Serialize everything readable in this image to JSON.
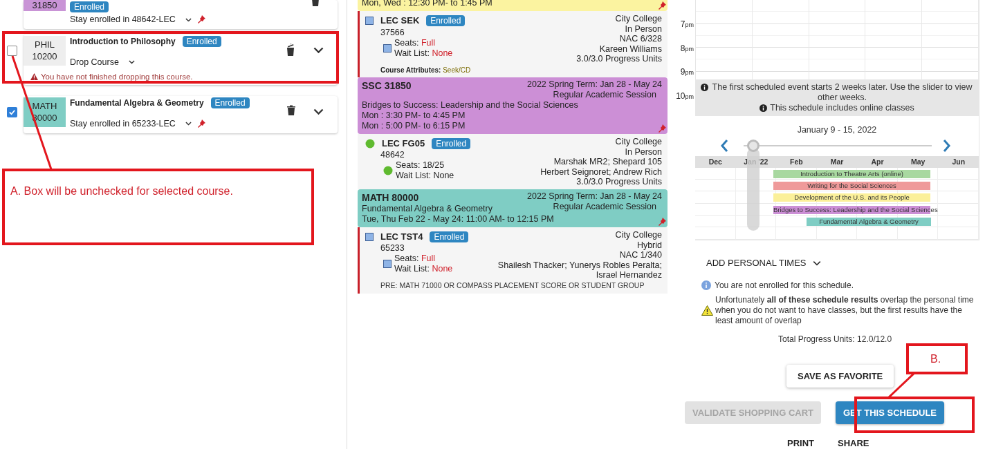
{
  "cart": [
    {
      "code": [
        "31850"
      ],
      "color": "#c994d6",
      "badge": "Enrolled",
      "action": "Stay enrolled in 48642-LEC",
      "pinned": true,
      "dropping": false
    },
    {
      "code": [
        "PHIL",
        "10200"
      ],
      "color": "#eeeeee",
      "title": "Introduction to Philosophy",
      "badge": "Enrolled",
      "action": "Drop Course",
      "pinned": false,
      "dropping": true,
      "checked": false,
      "warning": "You have not finished dropping this course."
    },
    {
      "code": [
        "MATH",
        "80000"
      ],
      "color": "#7fcdc4",
      "title": "Fundamental Algebra & Geometry",
      "badge": "Enrolled",
      "action": "Stay enrolled in 65233-LEC",
      "pinned": true,
      "dropping": false,
      "checked": true
    }
  ],
  "sections": [
    {
      "kind": "header",
      "color": "#fbf3a0",
      "times": [
        "Mon, Wed : 12:30 PM- to 1:45 PM"
      ],
      "pinned": true
    },
    {
      "kind": "component",
      "open": false,
      "name": "LEC SEK",
      "badge": "Enrolled",
      "number": "37566",
      "seats_label": "Seats:",
      "seats": "Full",
      "wait_label": "Wait List:",
      "wait": "None",
      "details": [
        "City College",
        "In Person",
        "NAC 6/328",
        "Kareen Williams",
        "3.0/3.0 Progress Units"
      ],
      "attributes_label": "Course Attributes:",
      "attributes_value": "Seek/CD"
    },
    {
      "kind": "header",
      "color": "#cc8fd6",
      "title": "SSC 31850",
      "term": "2022 Spring Term: Jan 28 - May 24",
      "session": "Regular Academic Session",
      "description": "Bridges to Success: Leadership and the Social Sciences",
      "times": [
        "Mon : 3:30 PM- to 4:45 PM",
        "Mon : 5:00 PM- to 6:15 PM"
      ],
      "pinned": true
    },
    {
      "kind": "component",
      "open": true,
      "name": "LEC FG05",
      "badge": "Enrolled",
      "number": "48642",
      "seats_label": "Seats:",
      "seats": "18/25",
      "wait_label": "Wait List:",
      "wait": "None",
      "details": [
        "City College",
        "In Person",
        "Marshak MR2; Shepard 105",
        "Herbert Seignoret; Andrew Rich",
        "3.0/3.0 Progress Units"
      ]
    },
    {
      "kind": "header",
      "color": "#7fcdc4",
      "title": "MATH 80000",
      "term": "2022 Spring Term: Jan 28 - May 24",
      "session": "Regular Academic Session",
      "description": "Fundamental Algebra & Geometry",
      "times": [
        "Tue, Thu Feb 22 - May 24: 11:00 AM- to 12:15 PM"
      ],
      "pinned": true
    },
    {
      "kind": "component",
      "open": false,
      "name": "LEC TST4",
      "badge": "Enrolled",
      "number": "65233",
      "seats_label": "Seats:",
      "seats": "Full",
      "wait_label": "Wait List:",
      "wait": "None",
      "details": [
        "City College",
        "Hybrid",
        "NAC 1/340",
        "Shailesh Thacker; Yunerys Robles Peralta;",
        "Israel Hernandez"
      ],
      "note": "PRE: MATH 71000 OR COMPASS PLACEMENT SCORE OR STUDENT GROUP"
    }
  ],
  "calendar": {
    "hours": [
      {
        "hour": "7",
        "suffix": "pm"
      },
      {
        "hour": "8",
        "suffix": "pm"
      },
      {
        "hour": "9",
        "suffix": "pm"
      },
      {
        "hour": "10",
        "suffix": "pm"
      }
    ],
    "notices": [
      "The first scheduled event starts 2 weeks later. Use the slider to view other weeks.",
      "This schedule includes online classes"
    ]
  },
  "week": {
    "label": "January 9 - 15, 2022",
    "level": 0.05
  },
  "timeline": {
    "months": [
      "Dec",
      "Jan '22",
      "Feb",
      "Mar",
      "Apr",
      "May",
      "Jun"
    ],
    "bars": [
      {
        "label": "Introduction to Theatre Arts (online)",
        "color": "#a8d8a0"
      },
      {
        "label": "Writing for the Social Sciences",
        "color": "#ef9a9a"
      },
      {
        "label": "Development of the U.S. and its People",
        "color": "#fbf09a"
      },
      {
        "label": "Bridges to Success: Leadership and the Social Sciences",
        "color": "#cc8fd6"
      },
      {
        "label": "Fundamental Algebra & Geometry",
        "color": "#7fcdc4"
      }
    ]
  },
  "personal_times": {
    "label": "ADD PERSONAL TIMES",
    "expanded": false
  },
  "info": "You are not enrolled for this schedule.",
  "warning": "Unfortunately **all of these schedule results** overlap the personal time when you do not want to have classes, but the first results have the least amount of overlap",
  "total": "Total Progress Units: 12.0/12.0",
  "buttons": [
    {
      "label": "SAVE AS FAVORITE",
      "kind": "favorite",
      "disabled": false
    },
    {
      "label": "VALIDATE SHOPPING CART",
      "kind": "validate",
      "disabled": true
    },
    {
      "label": "GET THIS SCHEDULE",
      "kind": "primary",
      "disabled": false
    }
  ],
  "links": [
    "PRINT",
    "SHARE"
  ],
  "annotations": [
    {
      "text": "A. Box will be unchecked for selected course."
    },
    {
      "text": "B."
    }
  ]
}
